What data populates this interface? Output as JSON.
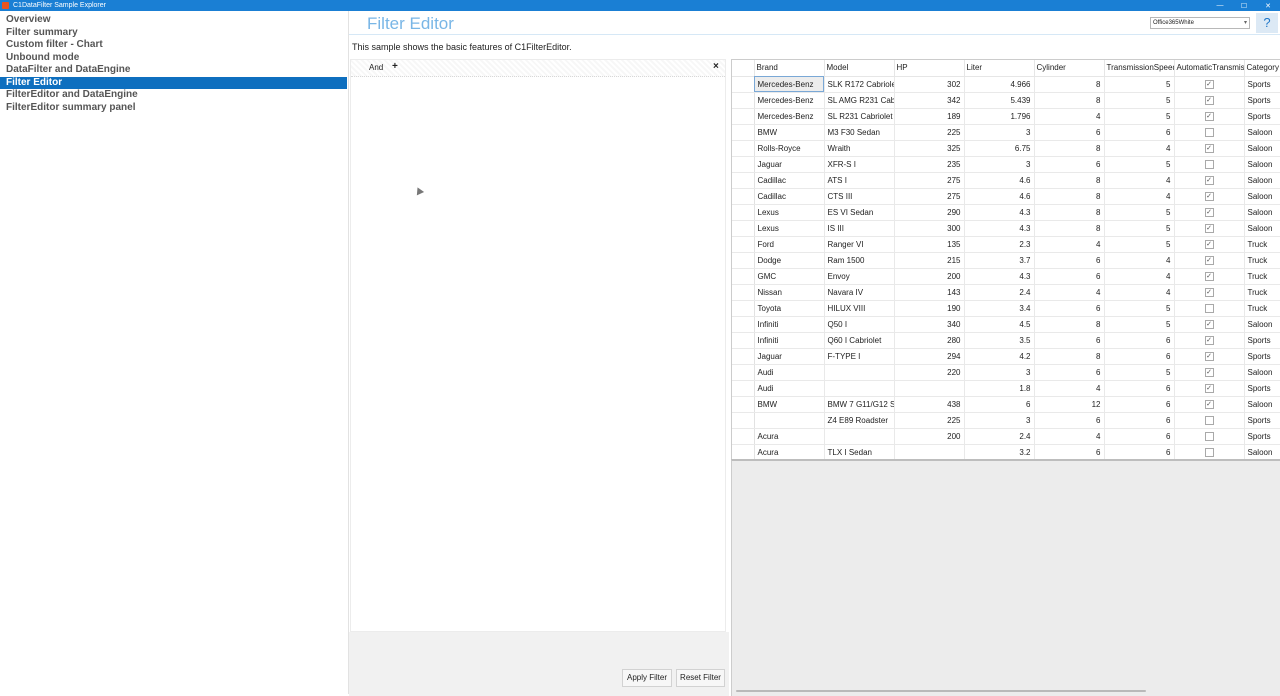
{
  "window": {
    "title": "C1DataFilter Sample Explorer",
    "minimize": "—",
    "maximize": "☐",
    "close": "✕"
  },
  "sidebar": {
    "items": [
      {
        "label": "Overview",
        "selected": false
      },
      {
        "label": "Filter summary",
        "selected": false
      },
      {
        "label": "Custom filter - Chart",
        "selected": false
      },
      {
        "label": "Unbound mode",
        "selected": false
      },
      {
        "label": "DataFilter and DataEngine",
        "selected": false
      },
      {
        "label": "Filter Editor",
        "selected": true
      },
      {
        "label": "FilterEditor and DataEngine",
        "selected": false
      },
      {
        "label": "FilterEditor summary panel",
        "selected": false
      }
    ]
  },
  "header": {
    "title": "Filter Editor",
    "theme_value": "Office365White",
    "help_label": "?"
  },
  "description": "This sample shows the basic features of C1FilterEditor.",
  "filter_editor": {
    "operator": "And",
    "add_label": "+",
    "close_label": "×"
  },
  "buttons": {
    "apply": "Apply Filter",
    "reset": "Reset Filter"
  },
  "grid": {
    "columns": [
      "Brand",
      "Model",
      "HP",
      "Liter",
      "Cylinder",
      "TransmissionSpeed",
      "AutomaticTransmis",
      "Category"
    ],
    "rows": [
      {
        "brand": "Mercedes-Benz",
        "model": "SLK R172 Cabriolet",
        "hp": "302",
        "liter": "4.966",
        "cyl": "8",
        "ts": "5",
        "auto": true,
        "cat": "Sports"
      },
      {
        "brand": "Mercedes-Benz",
        "model": "SL AMG R231 Cabr",
        "hp": "342",
        "liter": "5.439",
        "cyl": "8",
        "ts": "5",
        "auto": true,
        "cat": "Sports"
      },
      {
        "brand": "Mercedes-Benz",
        "model": "SL R231 Cabriolet",
        "hp": "189",
        "liter": "1.796",
        "cyl": "4",
        "ts": "5",
        "auto": true,
        "cat": "Sports"
      },
      {
        "brand": "BMW",
        "model": "M3 F30 Sedan",
        "hp": "225",
        "liter": "3",
        "cyl": "6",
        "ts": "6",
        "auto": false,
        "cat": "Saloon"
      },
      {
        "brand": "Rolls-Royce",
        "model": "Wraith",
        "hp": "325",
        "liter": "6.75",
        "cyl": "8",
        "ts": "4",
        "auto": true,
        "cat": "Saloon"
      },
      {
        "brand": "Jaguar",
        "model": "XFR-S I",
        "hp": "235",
        "liter": "3",
        "cyl": "6",
        "ts": "5",
        "auto": false,
        "cat": "Saloon"
      },
      {
        "brand": "Cadillac",
        "model": "ATS I",
        "hp": "275",
        "liter": "4.6",
        "cyl": "8",
        "ts": "4",
        "auto": true,
        "cat": "Saloon"
      },
      {
        "brand": "Cadillac",
        "model": "CTS III",
        "hp": "275",
        "liter": "4.6",
        "cyl": "8",
        "ts": "4",
        "auto": true,
        "cat": "Saloon"
      },
      {
        "brand": "Lexus",
        "model": "ES VI Sedan",
        "hp": "290",
        "liter": "4.3",
        "cyl": "8",
        "ts": "5",
        "auto": true,
        "cat": "Saloon"
      },
      {
        "brand": "Lexus",
        "model": "IS III",
        "hp": "300",
        "liter": "4.3",
        "cyl": "8",
        "ts": "5",
        "auto": true,
        "cat": "Saloon"
      },
      {
        "brand": "Ford",
        "model": "Ranger VI",
        "hp": "135",
        "liter": "2.3",
        "cyl": "4",
        "ts": "5",
        "auto": true,
        "cat": "Truck"
      },
      {
        "brand": "Dodge",
        "model": "Ram 1500",
        "hp": "215",
        "liter": "3.7",
        "cyl": "6",
        "ts": "4",
        "auto": true,
        "cat": "Truck"
      },
      {
        "brand": "GMC",
        "model": "Envoy",
        "hp": "200",
        "liter": "4.3",
        "cyl": "6",
        "ts": "4",
        "auto": true,
        "cat": "Truck"
      },
      {
        "brand": "Nissan",
        "model": "Navara IV",
        "hp": "143",
        "liter": "2.4",
        "cyl": "4",
        "ts": "4",
        "auto": true,
        "cat": "Truck"
      },
      {
        "brand": "Toyota",
        "model": "HILUX VIII",
        "hp": "190",
        "liter": "3.4",
        "cyl": "6",
        "ts": "5",
        "auto": false,
        "cat": "Truck"
      },
      {
        "brand": "Infiniti",
        "model": "Q50 I",
        "hp": "340",
        "liter": "4.5",
        "cyl": "8",
        "ts": "5",
        "auto": true,
        "cat": "Saloon"
      },
      {
        "brand": "Infiniti",
        "model": "Q60 I Cabriolet",
        "hp": "280",
        "liter": "3.5",
        "cyl": "6",
        "ts": "6",
        "auto": true,
        "cat": "Sports"
      },
      {
        "brand": "Jaguar",
        "model": "F-TYPE I",
        "hp": "294",
        "liter": "4.2",
        "cyl": "8",
        "ts": "6",
        "auto": true,
        "cat": "Sports"
      },
      {
        "brand": "Audi",
        "model": "",
        "hp": "220",
        "liter": "3",
        "cyl": "6",
        "ts": "5",
        "auto": true,
        "cat": "Saloon"
      },
      {
        "brand": "Audi",
        "model": "",
        "hp": "",
        "liter": "1.8",
        "cyl": "4",
        "ts": "6",
        "auto": true,
        "cat": "Sports"
      },
      {
        "brand": "BMW",
        "model": "BMW 7 G11/G12 S",
        "hp": "438",
        "liter": "6",
        "cyl": "12",
        "ts": "6",
        "auto": true,
        "cat": "Saloon"
      },
      {
        "brand": "",
        "model": "Z4 E89 Roadster",
        "hp": "225",
        "liter": "3",
        "cyl": "6",
        "ts": "6",
        "auto": false,
        "cat": "Sports"
      },
      {
        "brand": "Acura",
        "model": "",
        "hp": "200",
        "liter": "2.4",
        "cyl": "4",
        "ts": "6",
        "auto": false,
        "cat": "Sports"
      },
      {
        "brand": "Acura",
        "model": "TLX I Sedan",
        "hp": "",
        "liter": "3.2",
        "cyl": "6",
        "ts": "6",
        "auto": false,
        "cat": "Saloon"
      }
    ]
  },
  "colors": {
    "titlebar": "#1a7fd4",
    "selected_item": "#0e6fbf",
    "page_title": "#79b6e6"
  }
}
